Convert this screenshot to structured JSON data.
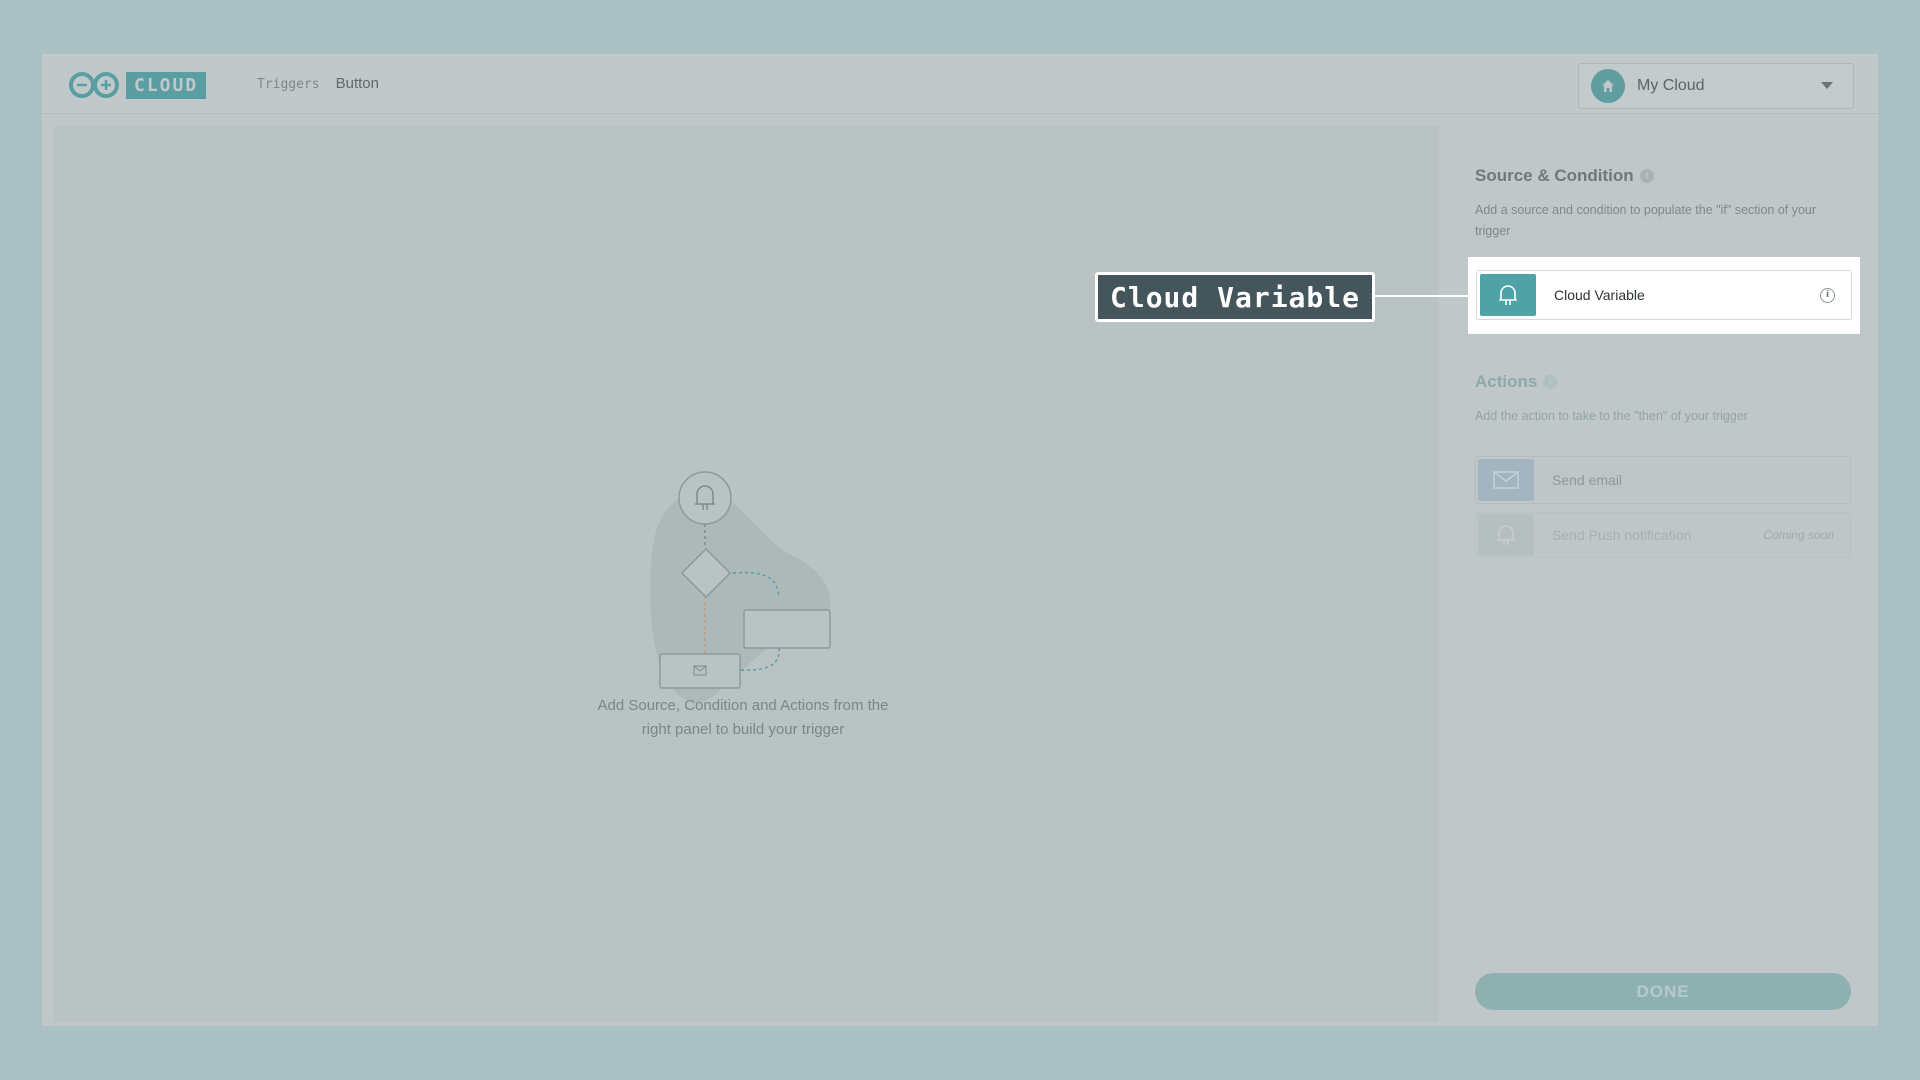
{
  "colors": {
    "brand_teal": "#4fa3a6",
    "overlay_bg": "#acc1c3",
    "callout_bg": "#44555b"
  },
  "header": {
    "logo_text": "CLOUD",
    "breadcrumb_link": "Triggers",
    "breadcrumb_current": "Button",
    "cloud_selector": {
      "name": "My Cloud",
      "avatar_icon": "home-icon",
      "caret_icon": "caret-down-icon"
    }
  },
  "canvas": {
    "empty_state_text": "Add Source, Condition and Actions from the right panel to build your trigger",
    "illustration_icons": [
      "bell-icon",
      "envelope-icon"
    ]
  },
  "panel": {
    "source": {
      "title": "Source & Condition",
      "description": "Add a source and condition to populate the \"if\" section of your trigger",
      "items": [
        {
          "label": "Cloud Variable",
          "icon": "bell-icon"
        }
      ]
    },
    "actions": {
      "title": "Actions",
      "description": "Add the action to take to the \"then\" of your trigger",
      "items": [
        {
          "label": "Send email",
          "icon": "envelope-icon"
        },
        {
          "label": "Send Push notification",
          "icon": "bell-icon",
          "note": "Coming soon"
        }
      ]
    },
    "done_label": "DONE"
  },
  "callout": {
    "label": "Cloud Variable"
  }
}
